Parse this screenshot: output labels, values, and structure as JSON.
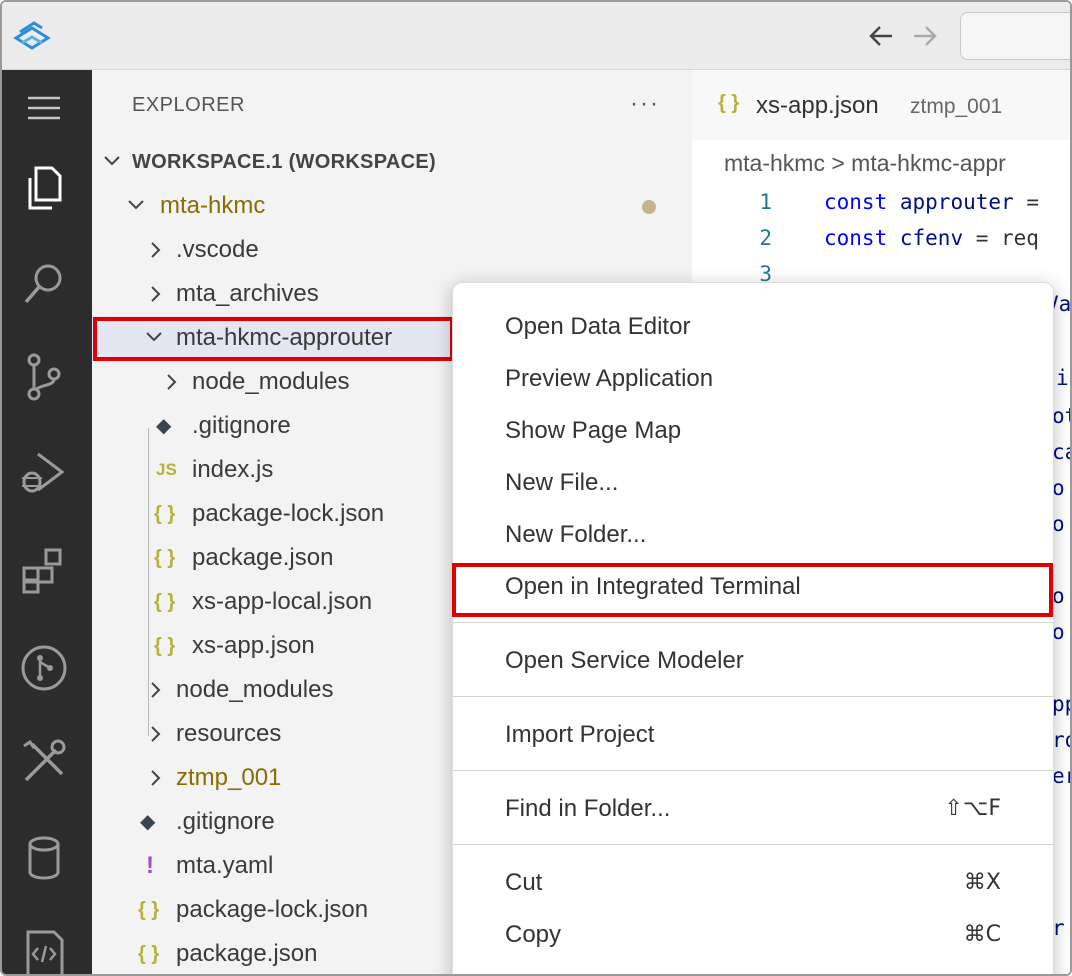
{
  "window": {
    "command_center_placeholder": ""
  },
  "sidebar": {
    "title": "EXPLORER",
    "more_label": "···",
    "workspace_label": "WORKSPACE.1 (WORKSPACE)",
    "tree": [
      {
        "label": "mta-hkmc",
        "kind": "folder-open",
        "level": 1,
        "modified": true
      },
      {
        "label": ".vscode",
        "kind": "folder",
        "level": 2
      },
      {
        "label": "mta_archives",
        "kind": "folder",
        "level": 2
      },
      {
        "label": "mta-hkmc-approuter",
        "kind": "folder-open",
        "level": 2,
        "selected": true
      },
      {
        "label": "node_modules",
        "kind": "folder",
        "level": 3
      },
      {
        "label": ".gitignore",
        "kind": "git",
        "level": 3
      },
      {
        "label": "index.js",
        "kind": "js",
        "level": 3
      },
      {
        "label": "package-lock.json",
        "kind": "json",
        "level": 3
      },
      {
        "label": "package.json",
        "kind": "json",
        "level": 3
      },
      {
        "label": "xs-app-local.json",
        "kind": "json",
        "level": 3
      },
      {
        "label": "xs-app.json",
        "kind": "json",
        "level": 3
      },
      {
        "label": "node_modules",
        "kind": "folder",
        "level": 2
      },
      {
        "label": "resources",
        "kind": "folder",
        "level": 2
      },
      {
        "label": "ztmp_001",
        "kind": "folder",
        "level": 2
      },
      {
        "label": ".gitignore",
        "kind": "git",
        "level": 2
      },
      {
        "label": "mta.yaml",
        "kind": "yaml",
        "level": 2
      },
      {
        "label": "package-lock.json",
        "kind": "json",
        "level": 2
      },
      {
        "label": "package.json",
        "kind": "json",
        "level": 2
      }
    ]
  },
  "icons": {
    "json": "{ }",
    "js": "JS",
    "yaml": "!",
    "git": "◆"
  },
  "editor": {
    "tab": {
      "icon": "{ }",
      "name": "xs-app.json",
      "dir": "ztmp_001"
    },
    "breadcrumb": "mta-hkmc > mta-hkmc-appr",
    "lines": [
      {
        "n": "1",
        "kw": "const",
        "name": "approuter",
        "rest": " ="
      },
      {
        "n": "2",
        "kw": "const",
        "name": "cfenv",
        "rest": " = req"
      },
      {
        "n": "3",
        "kw": "",
        "name": "",
        "rest": ""
      }
    ],
    "fragments": [
      "Va",
      "i",
      "ot",
      "ca",
      "o",
      "o",
      "o",
      "o",
      "pp",
      "ro",
      "er",
      "r"
    ]
  },
  "context_menu": {
    "items": [
      {
        "label": "Open Data Editor",
        "shortcut": ""
      },
      {
        "label": "Preview Application",
        "shortcut": ""
      },
      {
        "label": "Show Page Map",
        "shortcut": ""
      },
      {
        "label": "New File...",
        "shortcut": ""
      },
      {
        "label": "New Folder...",
        "shortcut": ""
      },
      {
        "label": "Open in Integrated Terminal",
        "shortcut": "",
        "highlighted": true
      },
      {
        "label": "Open Service Modeler",
        "shortcut": ""
      },
      {
        "label": "Import Project",
        "shortcut": ""
      },
      {
        "label": "Find in Folder...",
        "shortcut": "⇧⌥F"
      },
      {
        "label": "Cut",
        "shortcut": "⌘X"
      },
      {
        "label": "Copy",
        "shortcut": "⌘C"
      }
    ]
  },
  "colors": {
    "accent_red": "#e00000",
    "folder_gold": "#8a6d00",
    "json_icon": "#b5b13a",
    "activity_bg": "#2c2c2c"
  }
}
